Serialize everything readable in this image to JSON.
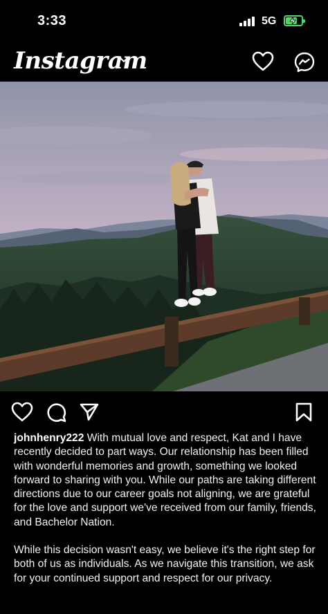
{
  "status_bar": {
    "time": "3:33",
    "network": "5G",
    "battery_charging": true,
    "battery_color": "#4cd964"
  },
  "header": {
    "app_name": "Instagram",
    "icons": [
      "chevron-down-icon",
      "heart-icon",
      "messenger-icon"
    ]
  },
  "post": {
    "actions": [
      "heart-icon",
      "comment-icon",
      "share-icon",
      "bookmark-icon"
    ],
    "username": "johnhenry222",
    "caption_p1": "With mutual love and respect, Kat and I have recently decided to part ways. Our relationship has been filled with wonderful memories and growth, something we looked forward to sharing with you. While our paths are taking different directions due to our career goals not aligning, we are grateful for the love and support we've received from our family, friends, and Bachelor Nation.",
    "caption_p2": "While this decision wasn't easy, we believe it's the right step for both of us as individuals. As we navigate this transition, we ask for your continued support and respect for our privacy."
  }
}
